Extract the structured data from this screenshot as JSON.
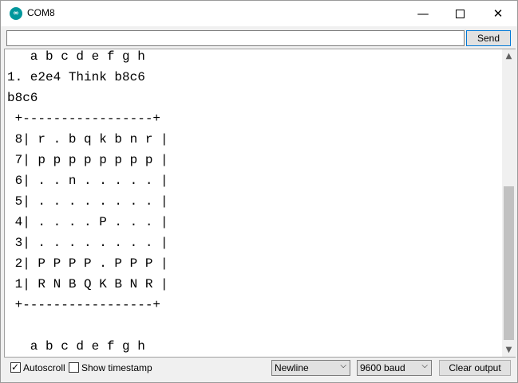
{
  "window": {
    "title": "COM8",
    "icon": "arduino-icon",
    "controls": {
      "minimize": "—",
      "close": "✕"
    }
  },
  "input": {
    "value": "",
    "send_label": "Send"
  },
  "output": {
    "lines": [
      "   a b c d e f g h",
      "1. e2e4 Think b8c6",
      "b8c6",
      " +-----------------+",
      " 8| r . b q k b n r |",
      " 7| p p p p p p p p |",
      " 6| . . n . . . . . |",
      " 5| . . . . . . . . |",
      " 4| . . . . P . . . |",
      " 3| . . . . . . . . |",
      " 2| P P P P . P P P |",
      " 1| R N B Q K B N R |",
      " +-----------------+",
      "",
      "   a b c d e f g h"
    ]
  },
  "scrollbar": {
    "up_arrow": "▲",
    "down_arrow": "▼"
  },
  "footer": {
    "autoscroll": {
      "label": "Autoscroll",
      "checked": true,
      "mark": "✓"
    },
    "timestamp": {
      "label": "Show timestamp",
      "checked": false
    },
    "line_ending": {
      "selected": "Newline",
      "arrow": "⌵"
    },
    "baud": {
      "selected": "9600 baud",
      "arrow": "⌵"
    },
    "clear_label": "Clear output"
  }
}
